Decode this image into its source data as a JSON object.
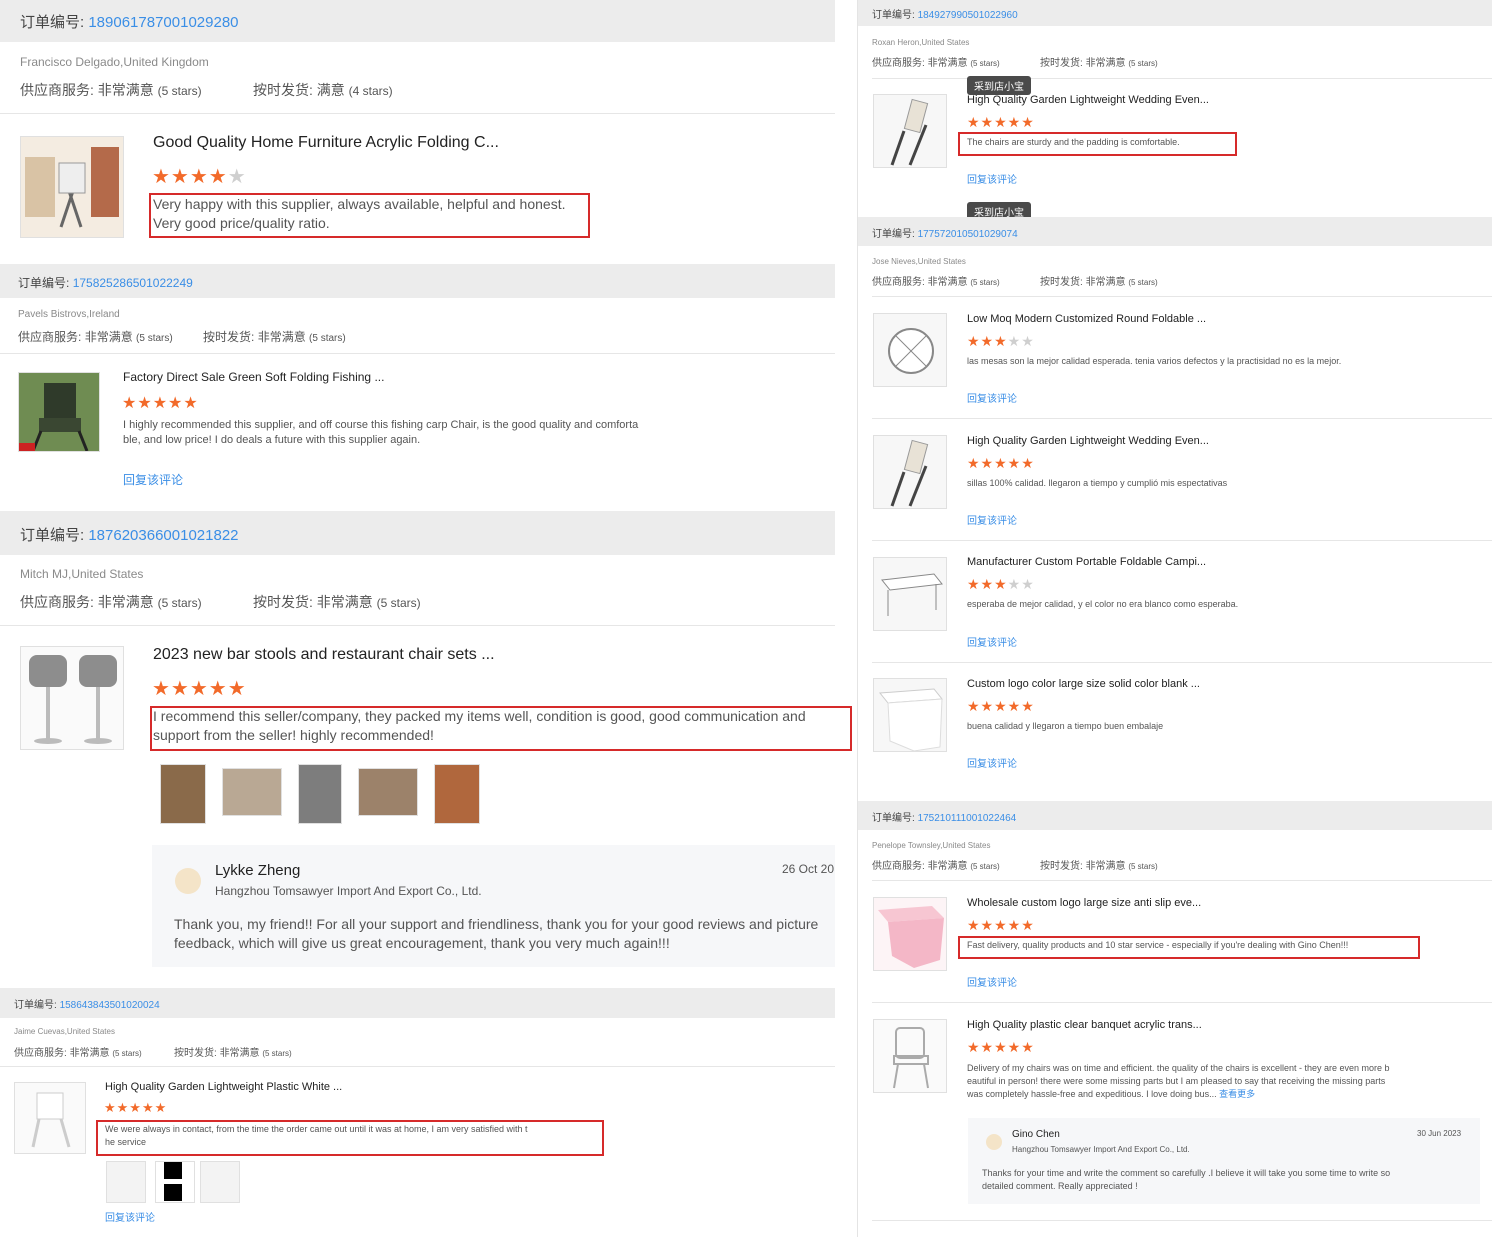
{
  "orders_left": [
    {
      "order_label": "订单编号:",
      "order_number": "189061787001029280",
      "buyer": "Francisco Delgado,United Kingdom",
      "supplier_label": "供应商服务:",
      "supplier_rating": "非常满意",
      "supplier_stars": "(5 stars)",
      "shipping_label": "按时发货:",
      "shipping_rating": "满意",
      "shipping_stars": "(4 stars)",
      "product_title": "Good Quality Home Furniture Acrylic Folding C...",
      "rating": 4,
      "comment_line1": "Very happy with this supplier, always available, helpful and honest.",
      "comment_line2": "Very good price/quality ratio."
    },
    {
      "order_label": "订单编号:",
      "order_number": "175825286501022249",
      "buyer": "Pavels Bistrovs,Ireland",
      "supplier_label": "供应商服务:",
      "supplier_rating": "非常满意",
      "supplier_stars": "(5 stars)",
      "shipping_label": "按时发货:",
      "shipping_rating": "非常满意",
      "shipping_stars": "(5 stars)",
      "product_title": "Factory Direct Sale Green Soft Folding Fishing ...",
      "rating": 5,
      "comment_line1": "I highly recommended this supplier, and off course this fishing carp Chair, is the good quality and comforta",
      "comment_line2": "ble, and low price! I do deals a future with this supplier again.",
      "reply_link": "回复该评论"
    },
    {
      "order_label": "订单编号:",
      "order_number": "187620366001021822",
      "buyer": "Mitch MJ,United States",
      "supplier_label": "供应商服务:",
      "supplier_rating": "非常满意",
      "supplier_stars": "(5 stars)",
      "shipping_label": "按时发货:",
      "shipping_rating": "非常满意",
      "shipping_stars": "(5 stars)",
      "product_title": "2023 new bar stools and restaurant chair sets ...",
      "rating": 5,
      "comment_line1": "I recommend this seller/company, they packed my items well, condition is good, good communication and",
      "comment_line2": "support from the seller! highly recommended!",
      "reply": {
        "name": "Lykke Zheng",
        "company": "Hangzhou Tomsawyer Import And Export Co., Ltd.",
        "date": "26 Oct 20",
        "line1": "Thank you, my friend!! For all your support and friendliness, thank you for your good reviews and picture",
        "line2": "feedback, which will give us great encouragement, thank you very much again!!!"
      }
    },
    {
      "order_label": "订单编号:",
      "order_number": "158643843501020024",
      "buyer": "Jaime Cuevas,United States",
      "supplier_label": "供应商服务:",
      "supplier_rating": "非常满意",
      "supplier_stars": "(5 stars)",
      "shipping_label": "按时发货:",
      "shipping_rating": "非常满意",
      "shipping_stars": "(5 stars)",
      "product_title": "High Quality Garden Lightweight Plastic White ...",
      "rating": 5,
      "comment_line1": "We were always in contact, from the time the order came out until it was at home, I am very satisfied with t",
      "comment_line2": "he service",
      "reply_link": "回复该评论"
    }
  ],
  "orders_right": [
    {
      "order_label": "订单编号:",
      "order_number": "184927990501022960",
      "buyer": "Roxan Heron,United States",
      "supplier_label": "供应商服务:",
      "supplier_rating": "非常满意",
      "supplier_stars": "(5 stars)",
      "shipping_label": "按时发货:",
      "shipping_rating": "非常满意",
      "shipping_stars": "(5 stars)",
      "tag": "采到店小宝",
      "product_title": "High Quality Garden Lightweight Wedding Even...",
      "rating": 5,
      "comment": "The chairs are sturdy and the padding is comfortable.",
      "reply_link": "回复该评论"
    },
    {
      "tag": "采到店小宝",
      "order_label": "订单编号:",
      "order_number": "177572010501029074",
      "buyer": "Jose Nieves,United States",
      "supplier_label": "供应商服务:",
      "supplier_rating": "非常满意",
      "supplier_stars": "(5 stars)",
      "shipping_label": "按时发货:",
      "shipping_rating": "非常满意",
      "shipping_stars": "(5 stars)",
      "items": [
        {
          "title": "Low Moq Modern Customized Round Foldable ...",
          "rating": 3,
          "comment": "las mesas son la mejor calidad esperada. tenia varios defectos y la practisidad no es la mejor.",
          "reply_link": "回复该评论"
        },
        {
          "title": "High Quality Garden Lightweight Wedding Even...",
          "rating": 5,
          "comment": "sillas 100% calidad. llegaron a tiempo y cumplió mis espectativas",
          "reply_link": "回复该评论"
        },
        {
          "title": "Manufacturer Custom Portable Foldable Campi...",
          "rating": 3,
          "comment": "esperaba de mejor calidad, y el color no era blanco como esperaba.",
          "reply_link": "回复该评论"
        },
        {
          "title": "Custom logo color large size solid color blank ...",
          "rating": 5,
          "comment": "buena calidad y llegaron a tiempo buen embalaje",
          "reply_link": "回复该评论"
        }
      ]
    },
    {
      "order_label": "订单编号:",
      "order_number": "175210111001022464",
      "buyer": "Penelope Townsley,United States",
      "supplier_label": "供应商服务:",
      "supplier_rating": "非常满意",
      "supplier_stars": "(5 stars)",
      "shipping_label": "按时发货:",
      "shipping_rating": "非常满意",
      "shipping_stars": "(5 stars)",
      "items": [
        {
          "title": "Wholesale custom logo large size anti slip eve...",
          "rating": 5,
          "comment": "Fast delivery, quality products and 10 star service - especially if you're dealing with Gino Chen!!!",
          "reply_link": "回复该评论"
        },
        {
          "title": "High Quality plastic clear banquet acrylic trans...",
          "rating": 5,
          "comment_line1": "Delivery of my chairs was on time and efficient.  the quality of the chairs is excellent - they are even more b",
          "comment_line2": "eautiful in person!  there were some missing parts but I am pleased to say that receiving the missing parts",
          "comment_line3": "was completely hassle-free and expeditious.  I love doing bus...",
          "more_link": "查看更多",
          "reply": {
            "name": "Gino Chen",
            "company": "Hangzhou Tomsawyer Import And Export Co., Ltd.",
            "date": "30 Jun 2023",
            "line1": "Thanks for your time and write the comment so carefully .I believe it will take you some time to write so",
            "line2": "detailed comment. Really appreciated !"
          }
        }
      ]
    }
  ],
  "colors": {
    "accent": "#3a8ee6",
    "star": "#f26a2a",
    "highlight": "#d62a2a",
    "bar": "#ececec"
  }
}
